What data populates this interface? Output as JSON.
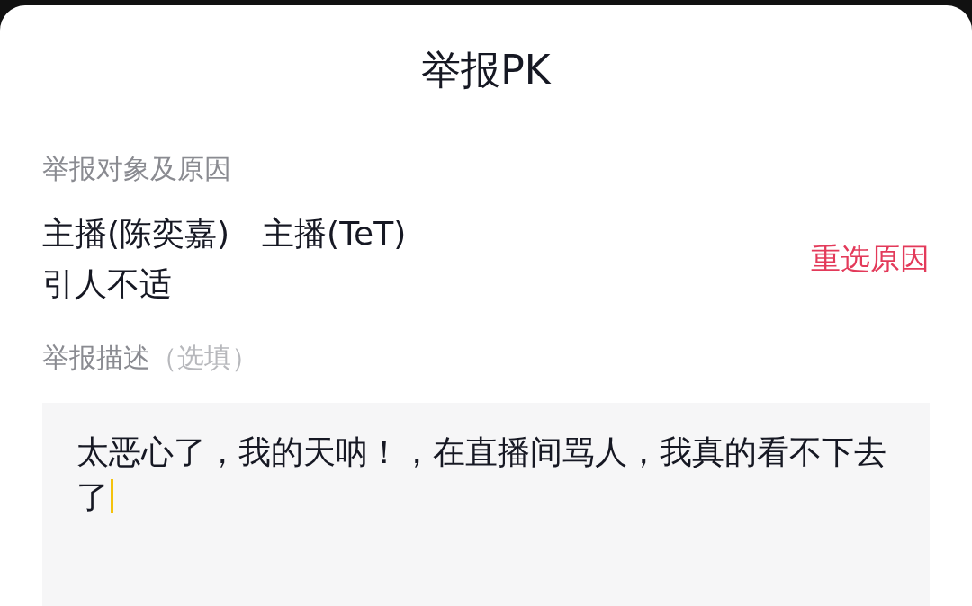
{
  "title": "举报PK",
  "target_section": {
    "label": "举报对象及原因",
    "targets": [
      "主播(陈奕嘉)",
      "主播(TeT)"
    ],
    "reason": "引人不适",
    "reselect_button": "重选原因"
  },
  "description_section": {
    "label": "举报描述",
    "hint": "（选填）",
    "value": "太恶心了，我的天呐！，在直播间骂人，我真的看不下去了",
    "focused": true
  }
}
